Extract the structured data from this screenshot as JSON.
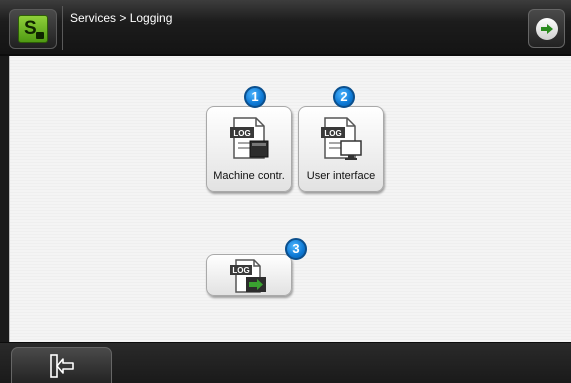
{
  "header": {
    "breadcrumb": "Services > Logging",
    "logo_icon": "s-logo-icon",
    "next_icon": "arrow-right-circle-icon"
  },
  "main": {
    "tiles": [
      {
        "badge": "1",
        "label": "Machine contr.",
        "icon": "log-machine-control-icon"
      },
      {
        "badge": "2",
        "label": "User interface",
        "icon": "log-user-interface-icon"
      },
      {
        "badge": "3",
        "label": "",
        "icon": "log-export-icon"
      }
    ]
  },
  "footer": {
    "exit_icon": "exit-door-icon"
  },
  "colors": {
    "header_bg": "#1c1c1c",
    "logo_green": "#6cb62a",
    "badge_blue": "#0d78d4",
    "export_arrow_green": "#3aa130"
  }
}
